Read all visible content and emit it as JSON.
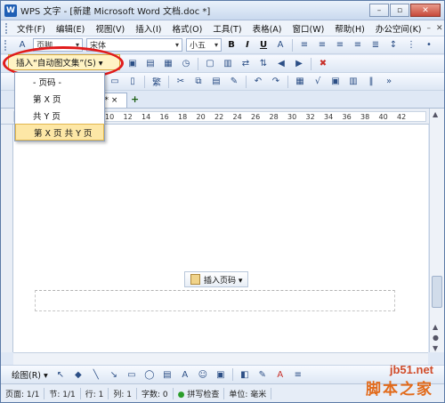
{
  "window": {
    "title": "WPS 文字 - [新建 Microsoft Word 文档.doc *]",
    "app_icon": "W"
  },
  "menu": [
    "文件(F)",
    "编辑(E)",
    "视图(V)",
    "插入(I)",
    "格式(O)",
    "工具(T)",
    "表格(A)",
    "窗口(W)",
    "帮助(H)",
    "办公空间(K)"
  ],
  "toolbar1": {
    "style": "页脚",
    "font": "宋体",
    "size": "小五",
    "bold": "B",
    "italic": "I",
    "underline": "U"
  },
  "toolbar2": {
    "autotext_button": "插入“自动图文集”(S) ▾"
  },
  "doc_tab": {
    "label": "* ×"
  },
  "ruler_numbers": [
    "2",
    "4",
    "6",
    "8",
    "10",
    "12",
    "14",
    "16",
    "18",
    "20",
    "22",
    "24",
    "26",
    "28",
    "30",
    "32",
    "34",
    "36",
    "38",
    "40",
    "42"
  ],
  "dropdown": {
    "items": [
      "- 页码 -",
      "第 X 页",
      "共 Y 页",
      "第 X 页 共 Y 页"
    ],
    "highlighted": 3
  },
  "insert_page_number": "插入页码 ▾",
  "drawing": {
    "label": "绘图(R) ▾"
  },
  "status": {
    "page": "页面: 1/1",
    "section": "节: 1/1",
    "row": "行: 1",
    "col": "列: 1",
    "words": "字数: 0",
    "spell": "拼写检查",
    "unit": "单位: 毫米"
  },
  "watermark": {
    "line1": "jb51.net",
    "line2": "脚本之家"
  }
}
